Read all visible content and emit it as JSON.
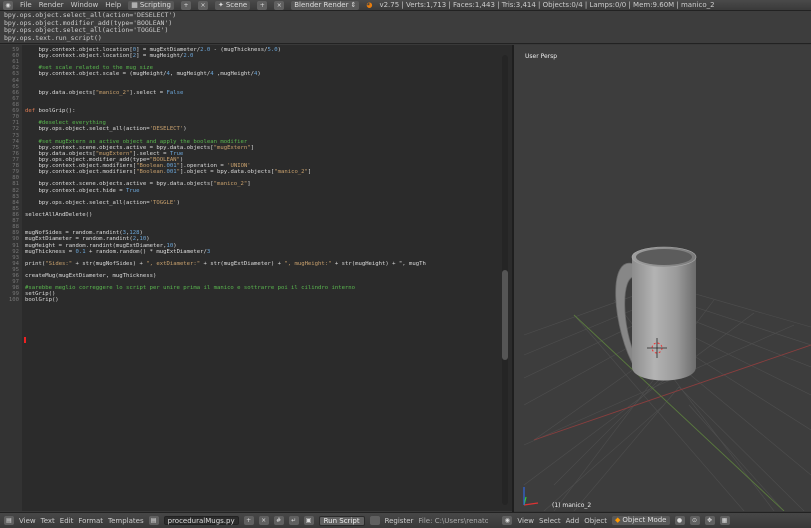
{
  "topbar": {
    "menus": [
      "File",
      "Render",
      "Window",
      "Help"
    ],
    "screen": "Scripting",
    "scene": "Scene",
    "engine": "Blender Render",
    "stats": "v2.75 | Verts:1,713 | Faces:1,443 | Tris:3,414 | Objects:0/4 | Lamps:0/0 | Mem:9.60M | manico_2"
  },
  "info_lines": [
    "bpy.ops.object.select_all(action='DESELECT')",
    "bpy.ops.object.modifier_add(type='BOOLEAN')",
    "bpy.ops.object.select_all(action='TOGGLE')",
    "bpy.ops.text.run_script()"
  ],
  "code": [
    {
      "n": "59",
      "t": "    bpy.context.object.location[0] = mugExtDiameter/2.0 - (mugThickness/5.0)"
    },
    {
      "n": "60",
      "t": "    bpy.context.object.location[2] = mugHeight/2.0"
    },
    {
      "n": "61",
      "t": ""
    },
    {
      "n": "62",
      "t": "    #set scale related to the mug size"
    },
    {
      "n": "63",
      "t": "    bpy.context.object.scale = (mugHeight/4, mugHeight/4 ,mugHeight/4)"
    },
    {
      "n": "64",
      "t": ""
    },
    {
      "n": "65",
      "t": ""
    },
    {
      "n": "66",
      "t": "    bpy.data.objects[\"manico_2\"].select = False"
    },
    {
      "n": "67",
      "t": ""
    },
    {
      "n": "68",
      "t": ""
    },
    {
      "n": "69",
      "t": "def boolGrip():"
    },
    {
      "n": "70",
      "t": ""
    },
    {
      "n": "71",
      "t": "    #deselect everything"
    },
    {
      "n": "72",
      "t": "    bpy.ops.object.select_all(action='DESELECT')"
    },
    {
      "n": "73",
      "t": ""
    },
    {
      "n": "74",
      "t": "    #set mugExtern as active object and apply the boolean modifier"
    },
    {
      "n": "75",
      "t": "    bpy.context.scene.objects.active = bpy.data.objects[\"mugExtern\"]"
    },
    {
      "n": "76",
      "t": "    bpy.data.objects[\"mugExtern\"].select = True"
    },
    {
      "n": "77",
      "t": "    bpy.ops.object.modifier_add(type=\"BOOLEAN\")"
    },
    {
      "n": "78",
      "t": "    bpy.context.object.modifiers[\"Boolean.001\"].operation = 'UNION'"
    },
    {
      "n": "79",
      "t": "    bpy.context.object.modifiers[\"Boolean.001\"].object = bpy.data.objects[\"manico_2\"]"
    },
    {
      "n": "80",
      "t": ""
    },
    {
      "n": "81",
      "t": "    bpy.context.scene.objects.active = bpy.data.objects[\"manico_2\"]"
    },
    {
      "n": "82",
      "t": "    bpy.context.object.hide = True"
    },
    {
      "n": "83",
      "t": ""
    },
    {
      "n": "84",
      "t": "    bpy.ops.object.select_all(action='TOGGLE')"
    },
    {
      "n": "85",
      "t": ""
    },
    {
      "n": "86",
      "t": "selectAllAndDelete()"
    },
    {
      "n": "87",
      "t": ""
    },
    {
      "n": "88",
      "t": ""
    },
    {
      "n": "89",
      "t": "mugNofSides = random.randint(3,128)"
    },
    {
      "n": "90",
      "t": "mugExtDiameter = random.randint(2,10)"
    },
    {
      "n": "91",
      "t": "mugHeight = random.randint(mugExtDiameter,10)"
    },
    {
      "n": "92",
      "t": "mugThickness = 0.1 + random.random() * mugExtDiameter/3"
    },
    {
      "n": "93",
      "t": ""
    },
    {
      "n": "94",
      "t": "print(\"Sides:\" + str(mugNofSides) + \", extDiameter:\" + str(mugExtDiameter) + \", mugHeight:\" + str(mugHeight) + \", mugTh"
    },
    {
      "n": "95",
      "t": ""
    },
    {
      "n": "96",
      "t": "createMug(mugExtDiameter, mugThickness)"
    },
    {
      "n": "97",
      "t": ""
    },
    {
      "n": "98",
      "t": "#sarebbe meglio correggere lo script per unire prima il manico e sottrarre poi il cilindro interno"
    },
    {
      "n": "99",
      "t": "setGrip()"
    },
    {
      "n": "100",
      "t": "boolGrip()"
    }
  ],
  "viewport": {
    "label": "User Persp",
    "object_label": "(1) manico_2"
  },
  "bottombar": {
    "menus": [
      "View",
      "Text",
      "Edit",
      "Format",
      "Templates"
    ],
    "filename": "proceduralMugs.py",
    "run_script": "Run Script",
    "register": "Register",
    "file_path": "File: C:\\Users\\renato\\Dr",
    "view_menus": [
      "View",
      "Select",
      "Add",
      "Object"
    ],
    "mode": "Object Mode"
  },
  "colors": {
    "keyword": "#e07c54",
    "comment": "#5ab84f",
    "string": "#c9a16d",
    "number": "#6ca6d8"
  }
}
